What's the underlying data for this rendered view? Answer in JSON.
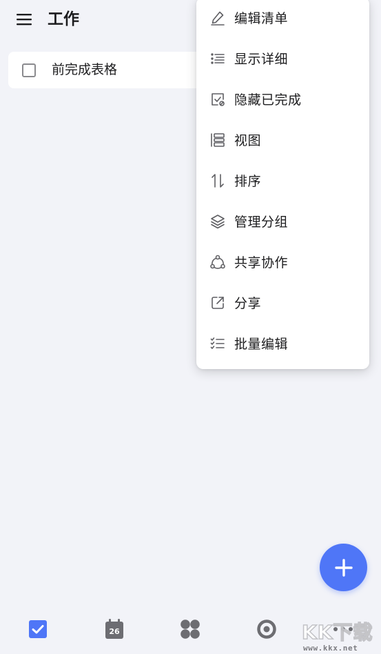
{
  "header": {
    "title": "工作",
    "menu_icon": "hamburger-menu-icon"
  },
  "tasks": [
    {
      "title": "前完成表格",
      "completed": false
    }
  ],
  "dropdown": {
    "items": [
      {
        "label": "编辑清单",
        "icon": "pencil-icon"
      },
      {
        "label": "显示详细",
        "icon": "list-detail-icon"
      },
      {
        "label": "隐藏已完成",
        "icon": "hide-completed-icon"
      },
      {
        "label": "视图",
        "icon": "view-icon"
      },
      {
        "label": "排序",
        "icon": "sort-icon"
      },
      {
        "label": "管理分组",
        "icon": "layers-icon"
      },
      {
        "label": "共享协作",
        "icon": "share-collab-icon"
      },
      {
        "label": "分享",
        "icon": "share-external-icon"
      },
      {
        "label": "批量编辑",
        "icon": "batch-edit-icon"
      }
    ]
  },
  "fab": {
    "icon": "plus-icon"
  },
  "bottom_nav": {
    "items": [
      {
        "icon": "task-checkbox-icon",
        "active": true
      },
      {
        "icon": "calendar-icon",
        "label": "26",
        "active": false
      },
      {
        "icon": "four-quadrant-icon",
        "active": false
      },
      {
        "icon": "focus-timer-icon",
        "active": false
      },
      {
        "icon": "more-dots-icon",
        "active": false
      }
    ]
  },
  "watermark": {
    "logo": "KK下载",
    "url": "www.kkx.net"
  },
  "colors": {
    "accent": "#4f76f7",
    "background": "#f2f3f8",
    "icon_gray": "#5f5f63",
    "text": "#1c1c1e"
  }
}
